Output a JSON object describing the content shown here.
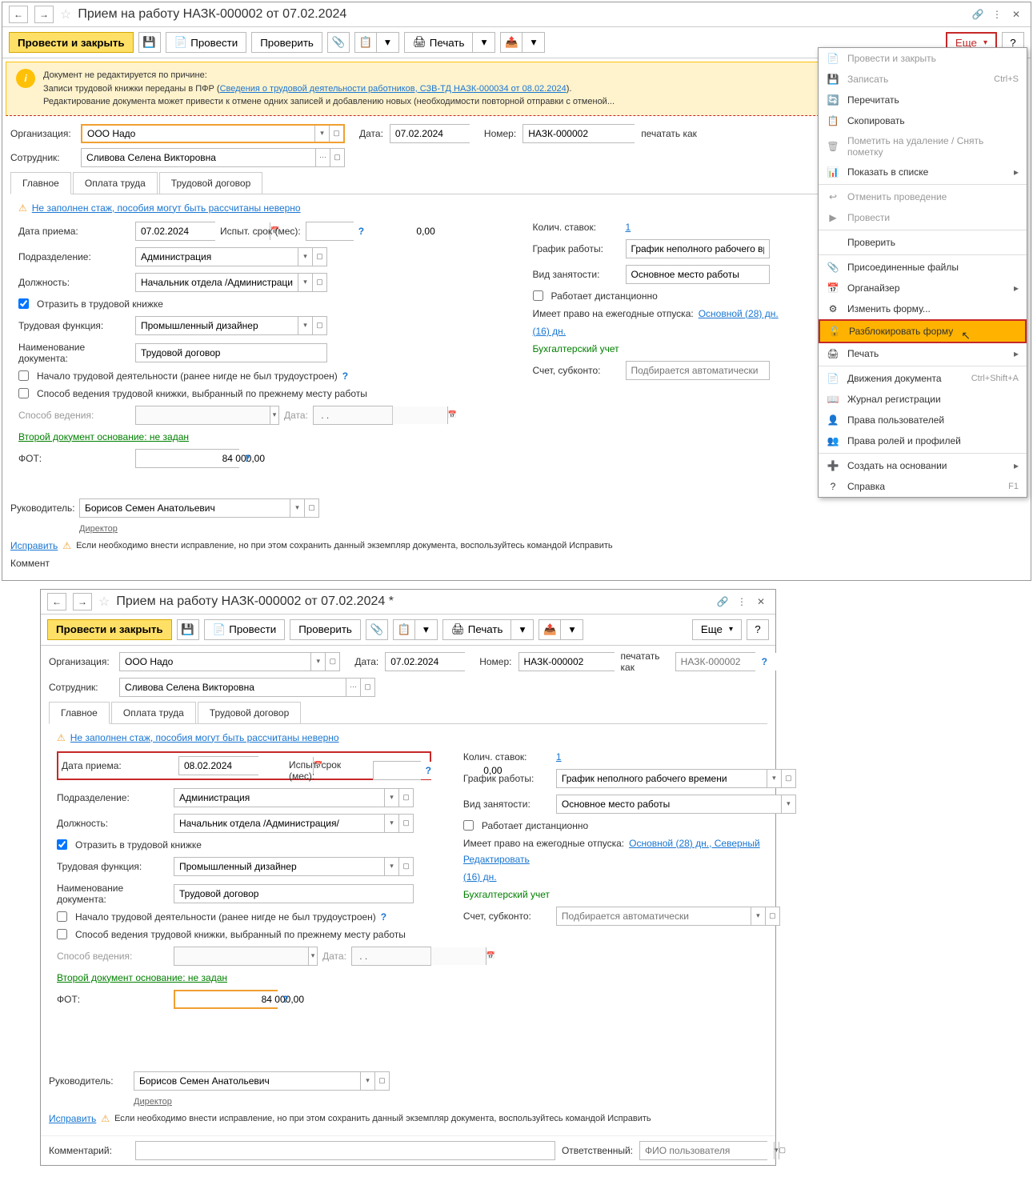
{
  "window1": {
    "title": "Прием на работу НАЗК-000002 от 07.02.2024",
    "toolbar": {
      "post_close": "Провести и закрыть",
      "post": "Провести",
      "check": "Проверить",
      "print": "Печать",
      "more": "Еще",
      "help": "?"
    },
    "warning": {
      "line1": "Документ не редактируется по причине:",
      "line2_a": "Записи трудовой книжки переданы в ПФР (",
      "line2_link": "Сведения о трудовой деятельности работников, СЗВ-ТД НАЗК-000034 от 08.02.2024",
      "line2_b": ").",
      "line3": "Редактирование документа может привести к отмене одних записей и добавлению новых (необходимости повторной отправки с отменой..."
    },
    "org_label": "Организация:",
    "org_value": "ООО Надо",
    "date_label": "Дата:",
    "date_value": "07.02.2024",
    "number_label": "Номер:",
    "number_value": "НАЗК-000002",
    "print_as": "печатать как",
    "employee_label": "Сотрудник:",
    "employee_value": "Сливова Селена Викторовна",
    "tabs": {
      "main": "Главное",
      "pay": "Оплата труда",
      "contract": "Трудовой договор"
    },
    "alert": "Не заполнен стаж, пособия могут быть рассчитаны неверно",
    "hire_date_label": "Дата приема:",
    "hire_date_value": "07.02.2024",
    "trial_label": "Испыт. срок (мес):",
    "trial_value": "0,00",
    "dept_label": "Подразделение:",
    "dept_value": "Администрация",
    "position_label": "Должность:",
    "position_value": "Начальник отдела /Администрация/",
    "reflect_book": "Отразить в трудовой книжке",
    "work_func_label": "Трудовая функция:",
    "work_func_value": "Промышленный дизайнер",
    "doc_name_label": "Наименование документа:",
    "doc_name_value": "Трудовой договор",
    "start_activity": "Начало трудовой деятельности (ранее нигде не был трудоустроен)",
    "book_method": "Способ ведения трудовой книжки, выбранный по прежнему месту работы",
    "method_label": "Способ ведения:",
    "method_date_label": "Дата:",
    "second_doc": "Второй документ основание: не задан",
    "fot_label": "ФОТ:",
    "fot_value": "84 000,00",
    "rates_label": "Колич. ставок:",
    "rates_value": "1",
    "schedule_label": "График работы:",
    "schedule_value": "График неполного рабочего времени",
    "employment_label": "Вид занятости:",
    "employment_value": "Основное место работы",
    "remote": "Работает дистанционно",
    "vacation_label": "Имеет право на ежегодные отпуска:",
    "vacation_val": "Основной (28) дн.",
    "vacation_days": "(16) дн.",
    "accounting": "Бухгалтерский учет",
    "account_label": "Счет, субконто:",
    "account_placeholder": "Подбирается автоматически",
    "manager_label": "Руководитель:",
    "manager_value": "Борисов Семен Анатольевич",
    "manager_pos": "Директор",
    "comment_label": "Коммент",
    "fix_link": "Исправить",
    "fix_text": "Если необходимо внести исправление, но при этом сохранить данный экземпляр документа, воспользуйтесь командой Исправить"
  },
  "menu": {
    "items": [
      {
        "icon": "📄",
        "label": "Провести и закрыть",
        "disabled": true
      },
      {
        "icon": "💾",
        "label": "Записать",
        "shortcut": "Ctrl+S",
        "disabled": true
      },
      {
        "icon": "🔄",
        "label": "Перечитать"
      },
      {
        "icon": "📋",
        "label": "Скопировать"
      },
      {
        "icon": "🗑",
        "label": "Пометить на удаление / Снять пометку",
        "disabled": true
      },
      {
        "icon": "📊",
        "label": "Показать в списке",
        "arrow": true
      },
      {
        "sep": true
      },
      {
        "icon": "↩",
        "label": "Отменить проведение",
        "disabled": true
      },
      {
        "icon": "▶",
        "label": "Провести",
        "disabled": true
      },
      {
        "sep": true
      },
      {
        "icon": "",
        "label": "Проверить"
      },
      {
        "sep": true
      },
      {
        "icon": "📎",
        "label": "Присоединенные файлы"
      },
      {
        "icon": "📅",
        "label": "Органайзер",
        "arrow": true
      },
      {
        "icon": "⚙",
        "label": "Изменить форму..."
      },
      {
        "icon": "🔓",
        "label": "Разблокировать форму",
        "highlighted": true
      },
      {
        "icon": "🖨",
        "label": "Печать",
        "arrow": true
      },
      {
        "sep": true
      },
      {
        "icon": "📄",
        "label": "Движения документа",
        "shortcut": "Ctrl+Shift+A"
      },
      {
        "icon": "📖",
        "label": "Журнал регистрации"
      },
      {
        "icon": "👤",
        "label": "Права пользователей"
      },
      {
        "icon": "👥",
        "label": "Права ролей и профилей"
      },
      {
        "sep": true
      },
      {
        "icon": "➕",
        "label": "Создать на основании",
        "arrow": true
      },
      {
        "icon": "?",
        "label": "Справка",
        "shortcut": "F1"
      }
    ]
  },
  "window2": {
    "title": "Прием на работу НАЗК-000002 от 07.02.2024 *",
    "hire_date_value": "08.02.2024",
    "number_placeholder": "НАЗК-000002",
    "fot_value": "84 000,00",
    "vacation_val": "Основной (28) дн., Северный",
    "edit_link": "Редактировать",
    "responsible_label": "Ответственный:",
    "responsible_placeholder": "ФИО пользователя",
    "comment_label": "Комментарий:"
  }
}
